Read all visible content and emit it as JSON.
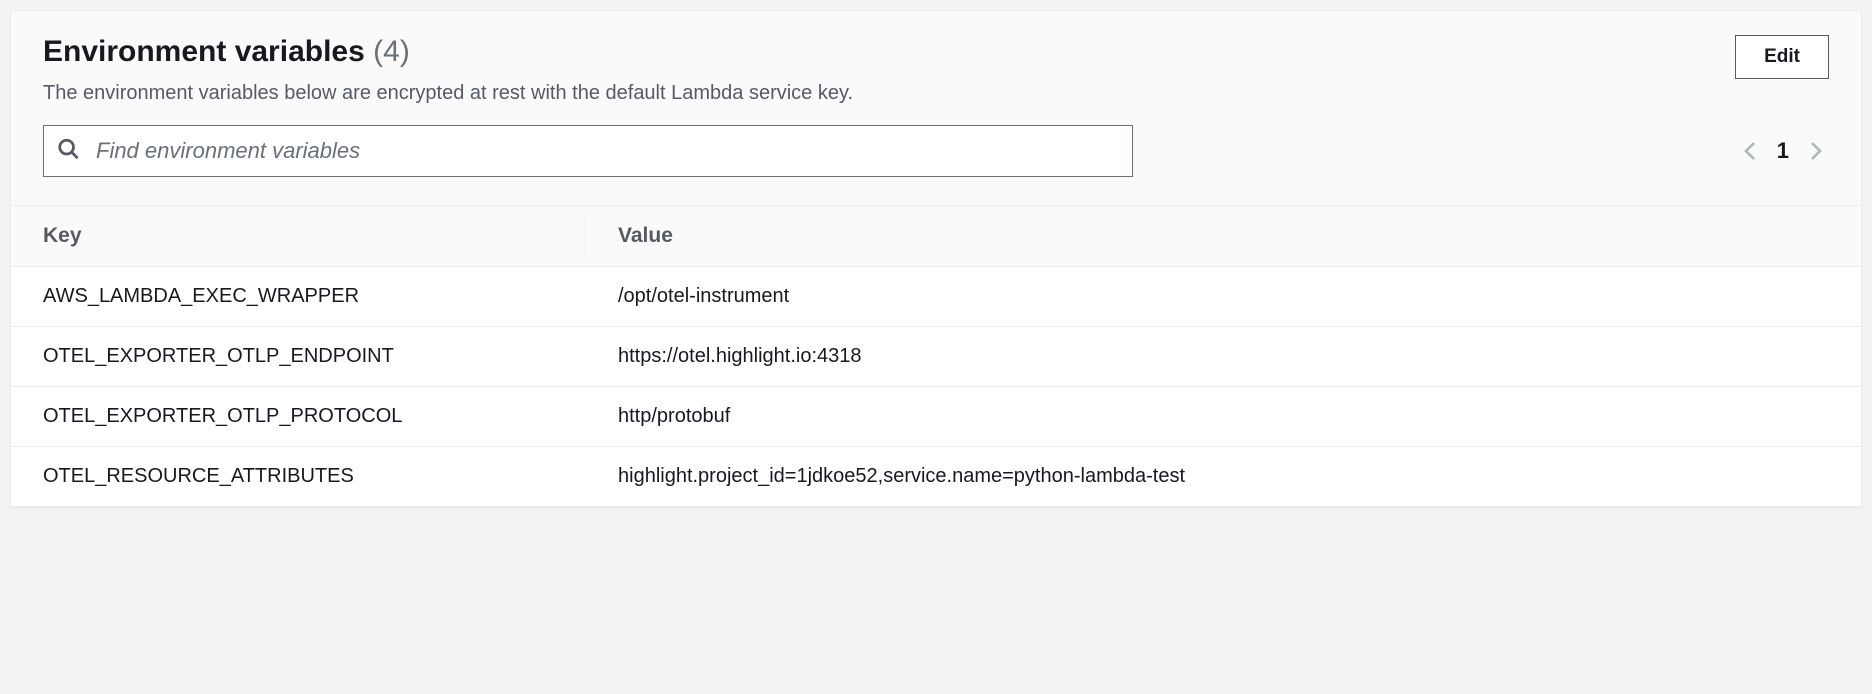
{
  "header": {
    "title": "Environment variables",
    "count": "(4)",
    "description": "The environment variables below are encrypted at rest with the default Lambda service key.",
    "edit_label": "Edit"
  },
  "search": {
    "placeholder": "Find environment variables"
  },
  "pagination": {
    "current": "1"
  },
  "table": {
    "headers": {
      "key": "Key",
      "value": "Value"
    },
    "rows": [
      {
        "key": "AWS_LAMBDA_EXEC_WRAPPER",
        "value": "/opt/otel-instrument"
      },
      {
        "key": "OTEL_EXPORTER_OTLP_ENDPOINT",
        "value": "https://otel.highlight.io:4318"
      },
      {
        "key": "OTEL_EXPORTER_OTLP_PROTOCOL",
        "value": "http/protobuf"
      },
      {
        "key": "OTEL_RESOURCE_ATTRIBUTES",
        "value": "highlight.project_id=1jdkoe52,service.name=python-lambda-test"
      }
    ]
  }
}
